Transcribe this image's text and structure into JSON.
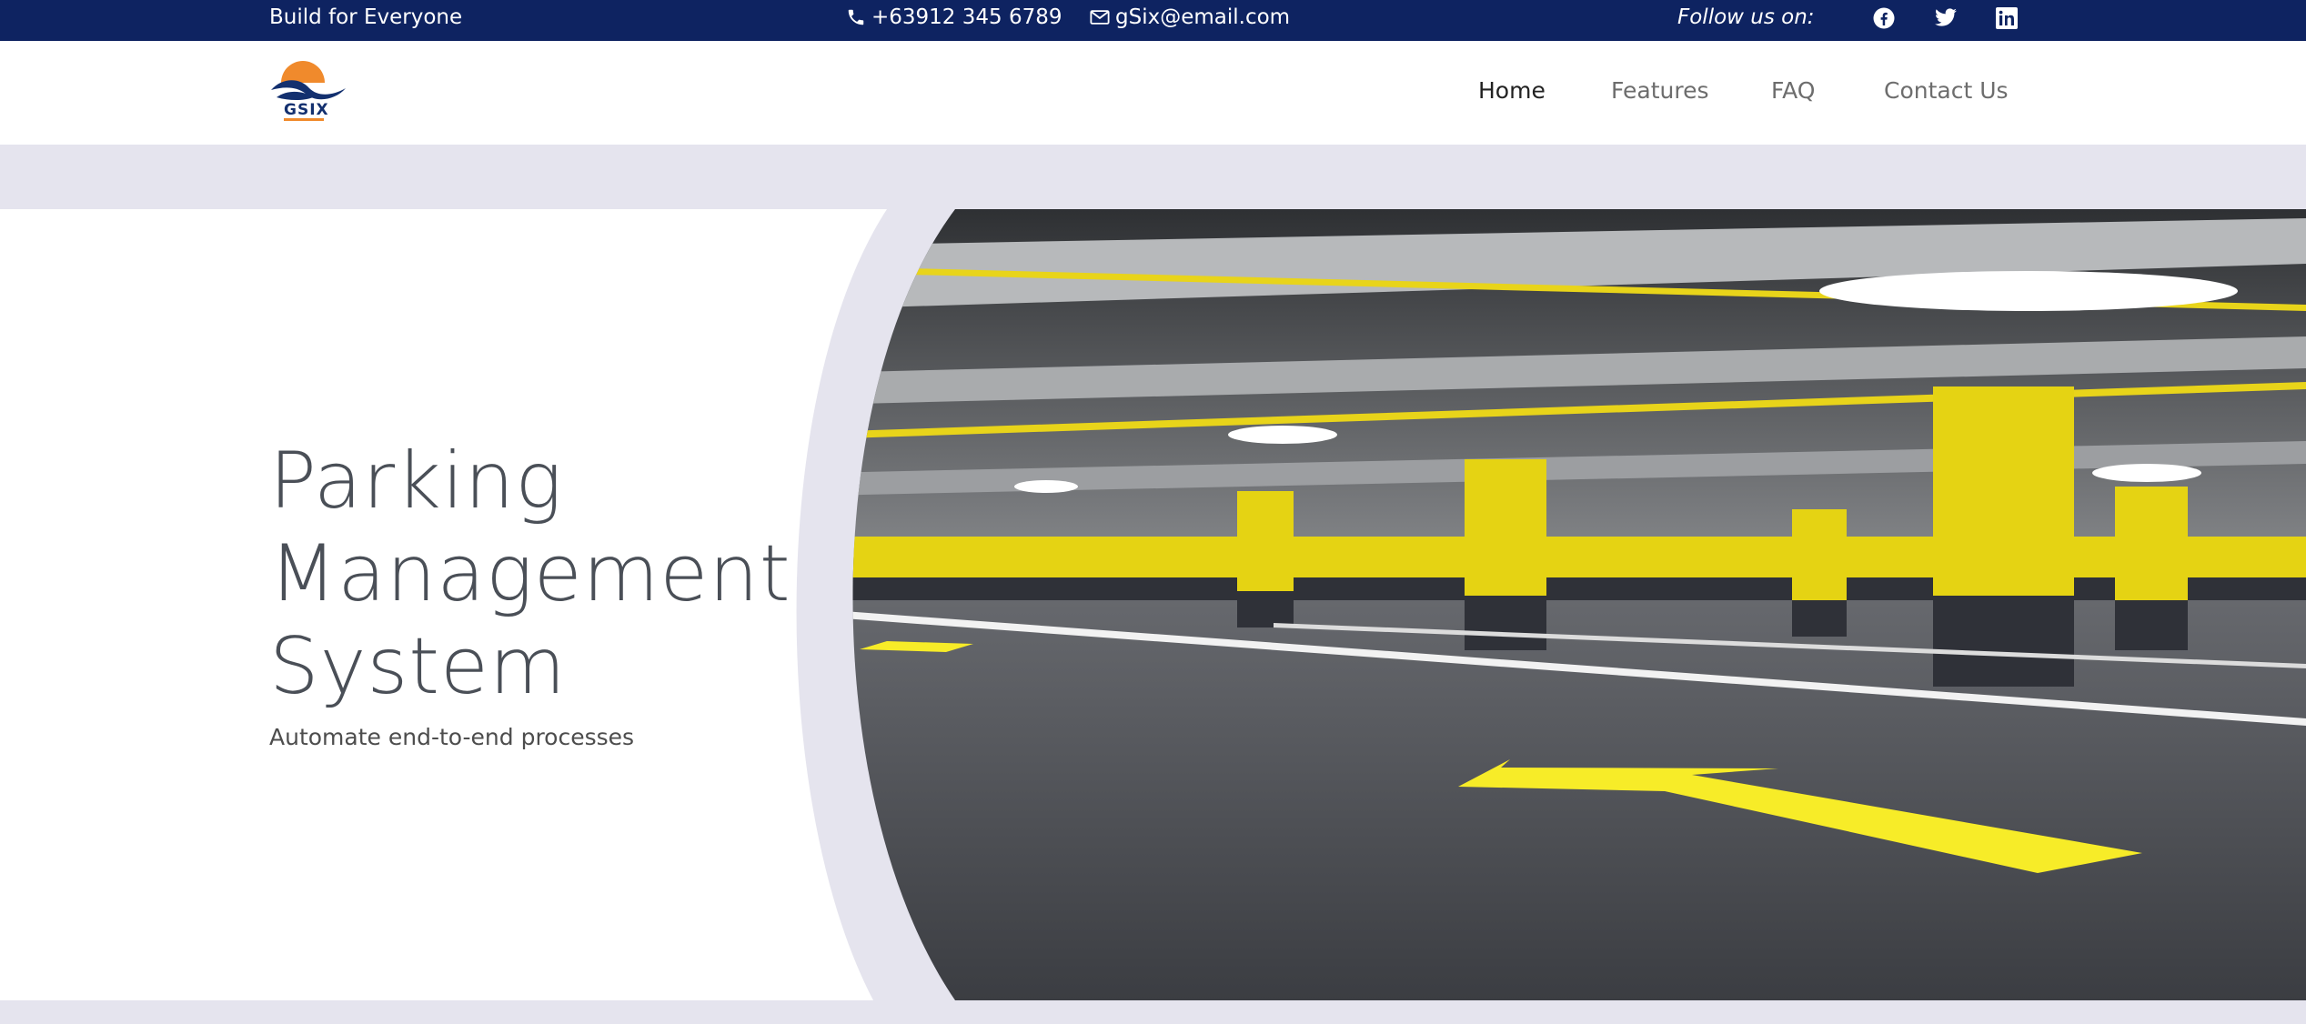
{
  "topbar": {
    "tagline": "Build for Everyone",
    "phone": "+63912 345 6789",
    "email": "gSix@email.com",
    "follow_label": "Follow us on:"
  },
  "header": {
    "logo_text": "GSIX",
    "nav": [
      {
        "label": "Home",
        "active": true
      },
      {
        "label": "Features",
        "active": false
      },
      {
        "label": "FAQ",
        "active": false
      },
      {
        "label": "Contact Us",
        "active": false
      }
    ]
  },
  "hero": {
    "title_lines": [
      "Parking",
      "Management",
      "System"
    ],
    "subtitle": "Automate end-to-end processes"
  },
  "colors": {
    "topbar_bg": "#0e2361",
    "page_bg": "#e5e4ee",
    "logo_orange": "#f08a2c",
    "pillar_yellow": "#e5d313",
    "floor_gray": "#4a4c52"
  },
  "icons": [
    "phone-icon",
    "mail-icon",
    "facebook-icon",
    "twitter-icon",
    "linkedin-icon"
  ]
}
